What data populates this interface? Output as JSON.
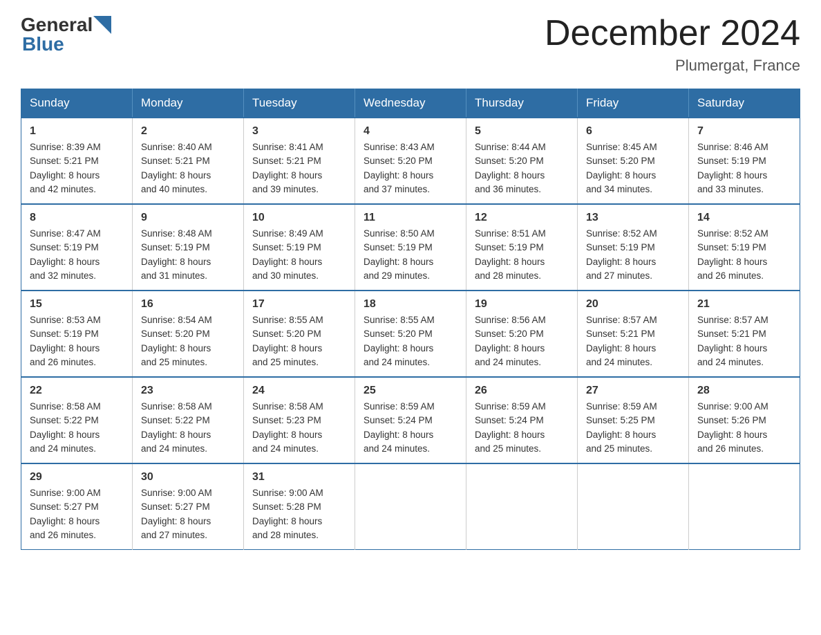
{
  "logo": {
    "general": "General",
    "blue": "Blue"
  },
  "title": "December 2024",
  "location": "Plumergat, France",
  "days_header": [
    "Sunday",
    "Monday",
    "Tuesday",
    "Wednesday",
    "Thursday",
    "Friday",
    "Saturday"
  ],
  "weeks": [
    [
      {
        "day": "1",
        "sunrise": "Sunrise: 8:39 AM",
        "sunset": "Sunset: 5:21 PM",
        "daylight": "Daylight: 8 hours",
        "daylight2": "and 42 minutes."
      },
      {
        "day": "2",
        "sunrise": "Sunrise: 8:40 AM",
        "sunset": "Sunset: 5:21 PM",
        "daylight": "Daylight: 8 hours",
        "daylight2": "and 40 minutes."
      },
      {
        "day": "3",
        "sunrise": "Sunrise: 8:41 AM",
        "sunset": "Sunset: 5:21 PM",
        "daylight": "Daylight: 8 hours",
        "daylight2": "and 39 minutes."
      },
      {
        "day": "4",
        "sunrise": "Sunrise: 8:43 AM",
        "sunset": "Sunset: 5:20 PM",
        "daylight": "Daylight: 8 hours",
        "daylight2": "and 37 minutes."
      },
      {
        "day": "5",
        "sunrise": "Sunrise: 8:44 AM",
        "sunset": "Sunset: 5:20 PM",
        "daylight": "Daylight: 8 hours",
        "daylight2": "and 36 minutes."
      },
      {
        "day": "6",
        "sunrise": "Sunrise: 8:45 AM",
        "sunset": "Sunset: 5:20 PM",
        "daylight": "Daylight: 8 hours",
        "daylight2": "and 34 minutes."
      },
      {
        "day": "7",
        "sunrise": "Sunrise: 8:46 AM",
        "sunset": "Sunset: 5:19 PM",
        "daylight": "Daylight: 8 hours",
        "daylight2": "and 33 minutes."
      }
    ],
    [
      {
        "day": "8",
        "sunrise": "Sunrise: 8:47 AM",
        "sunset": "Sunset: 5:19 PM",
        "daylight": "Daylight: 8 hours",
        "daylight2": "and 32 minutes."
      },
      {
        "day": "9",
        "sunrise": "Sunrise: 8:48 AM",
        "sunset": "Sunset: 5:19 PM",
        "daylight": "Daylight: 8 hours",
        "daylight2": "and 31 minutes."
      },
      {
        "day": "10",
        "sunrise": "Sunrise: 8:49 AM",
        "sunset": "Sunset: 5:19 PM",
        "daylight": "Daylight: 8 hours",
        "daylight2": "and 30 minutes."
      },
      {
        "day": "11",
        "sunrise": "Sunrise: 8:50 AM",
        "sunset": "Sunset: 5:19 PM",
        "daylight": "Daylight: 8 hours",
        "daylight2": "and 29 minutes."
      },
      {
        "day": "12",
        "sunrise": "Sunrise: 8:51 AM",
        "sunset": "Sunset: 5:19 PM",
        "daylight": "Daylight: 8 hours",
        "daylight2": "and 28 minutes."
      },
      {
        "day": "13",
        "sunrise": "Sunrise: 8:52 AM",
        "sunset": "Sunset: 5:19 PM",
        "daylight": "Daylight: 8 hours",
        "daylight2": "and 27 minutes."
      },
      {
        "day": "14",
        "sunrise": "Sunrise: 8:52 AM",
        "sunset": "Sunset: 5:19 PM",
        "daylight": "Daylight: 8 hours",
        "daylight2": "and 26 minutes."
      }
    ],
    [
      {
        "day": "15",
        "sunrise": "Sunrise: 8:53 AM",
        "sunset": "Sunset: 5:19 PM",
        "daylight": "Daylight: 8 hours",
        "daylight2": "and 26 minutes."
      },
      {
        "day": "16",
        "sunrise": "Sunrise: 8:54 AM",
        "sunset": "Sunset: 5:20 PM",
        "daylight": "Daylight: 8 hours",
        "daylight2": "and 25 minutes."
      },
      {
        "day": "17",
        "sunrise": "Sunrise: 8:55 AM",
        "sunset": "Sunset: 5:20 PM",
        "daylight": "Daylight: 8 hours",
        "daylight2": "and 25 minutes."
      },
      {
        "day": "18",
        "sunrise": "Sunrise: 8:55 AM",
        "sunset": "Sunset: 5:20 PM",
        "daylight": "Daylight: 8 hours",
        "daylight2": "and 24 minutes."
      },
      {
        "day": "19",
        "sunrise": "Sunrise: 8:56 AM",
        "sunset": "Sunset: 5:20 PM",
        "daylight": "Daylight: 8 hours",
        "daylight2": "and 24 minutes."
      },
      {
        "day": "20",
        "sunrise": "Sunrise: 8:57 AM",
        "sunset": "Sunset: 5:21 PM",
        "daylight": "Daylight: 8 hours",
        "daylight2": "and 24 minutes."
      },
      {
        "day": "21",
        "sunrise": "Sunrise: 8:57 AM",
        "sunset": "Sunset: 5:21 PM",
        "daylight": "Daylight: 8 hours",
        "daylight2": "and 24 minutes."
      }
    ],
    [
      {
        "day": "22",
        "sunrise": "Sunrise: 8:58 AM",
        "sunset": "Sunset: 5:22 PM",
        "daylight": "Daylight: 8 hours",
        "daylight2": "and 24 minutes."
      },
      {
        "day": "23",
        "sunrise": "Sunrise: 8:58 AM",
        "sunset": "Sunset: 5:22 PM",
        "daylight": "Daylight: 8 hours",
        "daylight2": "and 24 minutes."
      },
      {
        "day": "24",
        "sunrise": "Sunrise: 8:58 AM",
        "sunset": "Sunset: 5:23 PM",
        "daylight": "Daylight: 8 hours",
        "daylight2": "and 24 minutes."
      },
      {
        "day": "25",
        "sunrise": "Sunrise: 8:59 AM",
        "sunset": "Sunset: 5:24 PM",
        "daylight": "Daylight: 8 hours",
        "daylight2": "and 24 minutes."
      },
      {
        "day": "26",
        "sunrise": "Sunrise: 8:59 AM",
        "sunset": "Sunset: 5:24 PM",
        "daylight": "Daylight: 8 hours",
        "daylight2": "and 25 minutes."
      },
      {
        "day": "27",
        "sunrise": "Sunrise: 8:59 AM",
        "sunset": "Sunset: 5:25 PM",
        "daylight": "Daylight: 8 hours",
        "daylight2": "and 25 minutes."
      },
      {
        "day": "28",
        "sunrise": "Sunrise: 9:00 AM",
        "sunset": "Sunset: 5:26 PM",
        "daylight": "Daylight: 8 hours",
        "daylight2": "and 26 minutes."
      }
    ],
    [
      {
        "day": "29",
        "sunrise": "Sunrise: 9:00 AM",
        "sunset": "Sunset: 5:27 PM",
        "daylight": "Daylight: 8 hours",
        "daylight2": "and 26 minutes."
      },
      {
        "day": "30",
        "sunrise": "Sunrise: 9:00 AM",
        "sunset": "Sunset: 5:27 PM",
        "daylight": "Daylight: 8 hours",
        "daylight2": "and 27 minutes."
      },
      {
        "day": "31",
        "sunrise": "Sunrise: 9:00 AM",
        "sunset": "Sunset: 5:28 PM",
        "daylight": "Daylight: 8 hours",
        "daylight2": "and 28 minutes."
      },
      null,
      null,
      null,
      null
    ]
  ]
}
